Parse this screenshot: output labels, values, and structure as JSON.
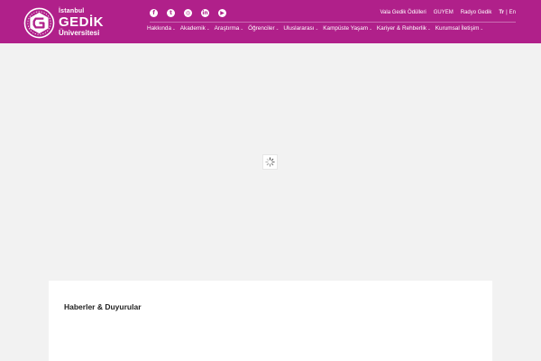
{
  "header": {
    "logo": {
      "top_text": "İstanbul",
      "main_text": "GEDİK",
      "bottom_text": "Üniversitesi",
      "icon": "gedik-emblem-icon"
    },
    "social": [
      {
        "name": "facebook-icon",
        "glyph": "f"
      },
      {
        "name": "twitter-icon",
        "glyph": "t"
      },
      {
        "name": "instagram-icon",
        "glyph": "◎"
      },
      {
        "name": "linkedin-icon",
        "glyph": "in"
      },
      {
        "name": "youtube-icon",
        "glyph": "▶"
      }
    ],
    "utility_links": {
      "vala": "Vala Gedik Ödülleri",
      "guyem": "GUYEM",
      "radio": "Radyo Gedik",
      "lang_tr": "Tr",
      "lang_sep": "|",
      "lang_en": "En"
    },
    "nav": [
      {
        "label": "Hakkında"
      },
      {
        "label": "Akademik"
      },
      {
        "label": "Araştırma"
      },
      {
        "label": "Öğrenciler"
      },
      {
        "label": "Uluslararası"
      },
      {
        "label": "Kampüste Yaşam"
      },
      {
        "label": "Kariyer & Rehberlik"
      },
      {
        "label": "Kurumsal İletişim"
      }
    ],
    "caret": "⌄"
  },
  "colors": {
    "brand": "#b0208a",
    "background": "#f2f2f2",
    "panel": "#ffffff"
  },
  "news": {
    "title": "Haberler & Duyurular"
  }
}
